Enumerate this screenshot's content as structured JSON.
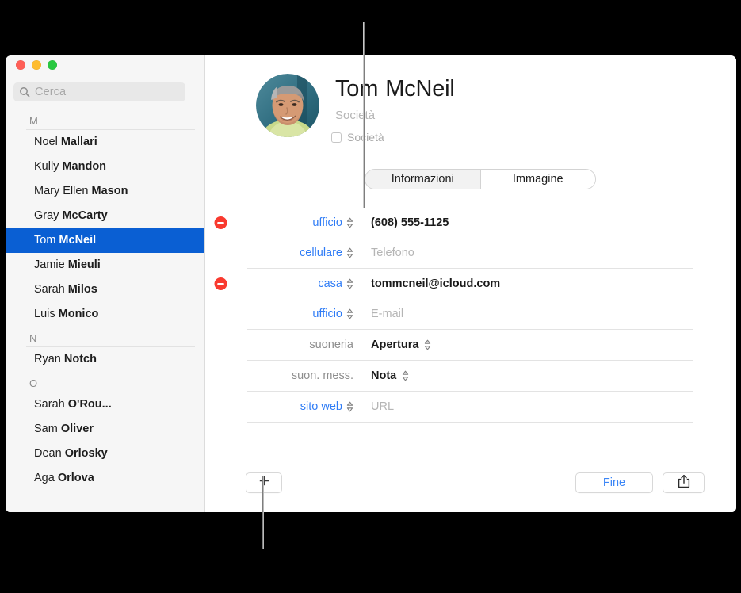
{
  "window": {
    "traffic_lights": [
      "close",
      "minimize",
      "zoom"
    ],
    "colors": {
      "close": "#ff5f57",
      "minimize": "#febc2e",
      "zoom": "#28c840",
      "selection": "#0a5fd3",
      "link": "#2f7cf6",
      "delete": "#f93a2f"
    }
  },
  "sidebar": {
    "search": {
      "placeholder": "Cerca",
      "value": "",
      "icon": "search-icon"
    },
    "groups": [
      {
        "letter": "M",
        "contacts": [
          {
            "given": "Noel",
            "family": "Mallari",
            "selected": false
          },
          {
            "given": "Kully",
            "family": "Mandon",
            "selected": false
          },
          {
            "given": "Mary Ellen",
            "family": "Mason",
            "selected": false
          },
          {
            "given": "Gray",
            "family": "McCarty",
            "selected": false
          },
          {
            "given": "Tom",
            "family": "McNeil",
            "selected": true
          },
          {
            "given": "Jamie",
            "family": "Mieuli",
            "selected": false
          },
          {
            "given": "Sarah",
            "family": "Milos",
            "selected": false
          },
          {
            "given": "Luis",
            "family": "Monico",
            "selected": false
          }
        ]
      },
      {
        "letter": "N",
        "contacts": [
          {
            "given": "Ryan",
            "family": "Notch",
            "selected": false
          }
        ]
      },
      {
        "letter": "O",
        "contacts": [
          {
            "given": "Sarah",
            "family": "O'Rou...",
            "selected": false
          },
          {
            "given": "Sam",
            "family": "Oliver",
            "selected": false
          },
          {
            "given": "Dean",
            "family": "Orlosky",
            "selected": false
          },
          {
            "given": "Aga",
            "family": "Orlova",
            "selected": false
          }
        ]
      }
    ]
  },
  "detail": {
    "avatar": "contact-photo",
    "first_name": "Tom",
    "last_name": "McNeil",
    "company_placeholder": "Società",
    "company_checkbox_label": "Società",
    "company_checkbox_checked": false,
    "tabs": [
      {
        "label": "Informazioni",
        "active": true
      },
      {
        "label": "Immagine",
        "active": false
      }
    ],
    "field_rows": [
      {
        "has_delete": true,
        "label": "ufficio",
        "label_link": true,
        "has_label_stepper": true,
        "value": "(608) 555-1125",
        "is_placeholder": false,
        "bold": true,
        "has_value_stepper": false
      },
      {
        "has_delete": false,
        "label": "cellulare",
        "label_link": true,
        "has_label_stepper": true,
        "value": "Telefono",
        "is_placeholder": true,
        "bold": false,
        "has_value_stepper": false
      },
      {
        "has_delete": true,
        "label": "casa",
        "label_link": true,
        "has_label_stepper": true,
        "value": "tommcneil@icloud.com",
        "is_placeholder": false,
        "bold": true,
        "has_value_stepper": false
      },
      {
        "has_delete": false,
        "label": "ufficio",
        "label_link": true,
        "has_label_stepper": true,
        "value": "E-mail",
        "is_placeholder": true,
        "bold": false,
        "has_value_stepper": false
      },
      {
        "has_delete": false,
        "label": "suoneria",
        "label_link": false,
        "has_label_stepper": false,
        "value": "Apertura",
        "is_placeholder": false,
        "bold": true,
        "has_value_stepper": true
      },
      {
        "has_delete": false,
        "label": "suon. mess.",
        "label_link": false,
        "has_label_stepper": false,
        "value": "Nota",
        "is_placeholder": false,
        "bold": true,
        "has_value_stepper": true
      },
      {
        "has_delete": false,
        "label": "sito web",
        "label_link": true,
        "has_label_stepper": true,
        "value": "URL",
        "is_placeholder": true,
        "bold": false,
        "has_value_stepper": false
      }
    ],
    "separators_after_row": [
      1,
      3,
      4,
      5,
      6
    ]
  },
  "bottom_bar": {
    "add_label": "+",
    "add_icon": "plus-icon",
    "done_label": "Fine",
    "share_icon": "share-icon"
  }
}
